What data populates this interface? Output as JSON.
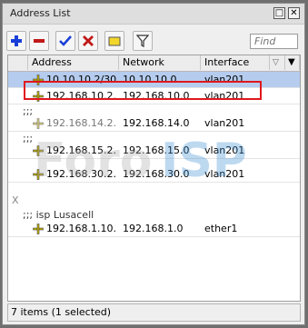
{
  "window": {
    "title": "Address List",
    "restore_label": "□",
    "close_label": "✕"
  },
  "toolbar": {
    "buttons": [
      "add-icon",
      "remove-icon",
      "enable-icon",
      "disable-icon",
      "comment-icon",
      "filter-icon"
    ],
    "find_placeholder": "Find"
  },
  "table": {
    "columns": [
      "Address",
      "Network",
      "Interface",
      "▽",
      "▼"
    ],
    "rows": [
      {
        "address": "10.10.10.2/30",
        "network": "10.10.10.0",
        "interface": "vlan201"
      },
      {
        "address": "192.168.10.2...",
        "network": "192.168.10.0",
        "interface": "vlan201"
      },
      {
        "address": "192.168.14.2...",
        "network": "192.168.14.0",
        "interface": "vlan201"
      },
      {
        "address": "192.168.15.2...",
        "network": "192.168.15.0",
        "interface": "vlan201"
      },
      {
        "address": "192.168.30.2...",
        "network": "192.168.30.0",
        "interface": "vlan201"
      },
      {
        "address": "192.168.1.10...",
        "network": "192.168.1.0",
        "interface": "ether1"
      }
    ],
    "comments": [
      ";;;",
      ";;;",
      "X",
      ";;; isp Lusacell"
    ]
  },
  "watermark": {
    "part1": "Foro",
    "part2": "ISP"
  },
  "status": "7 items (1 selected)",
  "colors": {
    "selected_row": "#b5ccee",
    "highlight_box": "#e0171d",
    "add_icon": "#1a3fd8",
    "remove_icon": "#c01818",
    "watermark_blue": "#3b8fd4"
  }
}
